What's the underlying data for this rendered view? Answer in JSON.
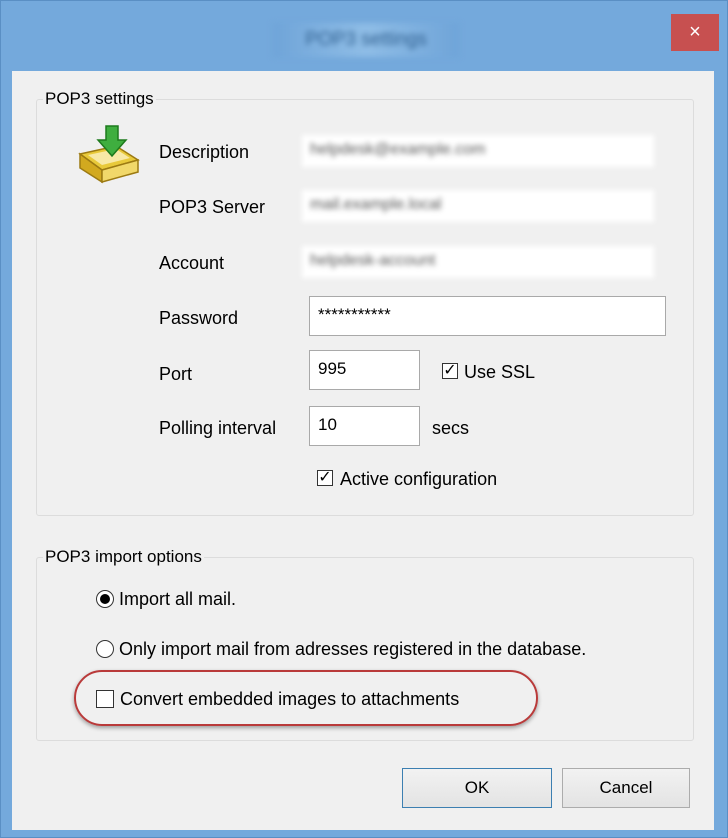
{
  "window": {
    "title": "POP3 settings"
  },
  "pop3_settings": {
    "group_label": "POP3 settings",
    "fields": {
      "description": {
        "label": "Description",
        "value": "helpdesk@example.com"
      },
      "server": {
        "label": "POP3 Server",
        "value": "mail.example.local"
      },
      "account": {
        "label": "Account",
        "value": "helpdesk-account"
      },
      "password": {
        "label": "Password",
        "value": "***********"
      },
      "port": {
        "label": "Port",
        "value": "995"
      },
      "polling": {
        "label": "Polling interval",
        "value": "10",
        "unit": "secs"
      }
    },
    "use_ssl": {
      "label": "Use SSL",
      "checked": true
    },
    "active_configuration": {
      "label": "Active configuration",
      "checked": true
    }
  },
  "import_options": {
    "group_label": "POP3 import options",
    "radio_all": {
      "label": "Import all mail.",
      "selected": true
    },
    "radio_registered": {
      "label": "Only import mail from adresses registered in the database.",
      "selected": false
    },
    "convert_images": {
      "label": "Convert embedded images to attachments",
      "checked": false
    }
  },
  "buttons": {
    "ok": "OK",
    "cancel": "Cancel"
  },
  "icons": {
    "close": "×",
    "check": "✓"
  },
  "colors": {
    "titlebar": "#74a9dc",
    "close": "#c75050",
    "highlight": "#b93a3a"
  }
}
